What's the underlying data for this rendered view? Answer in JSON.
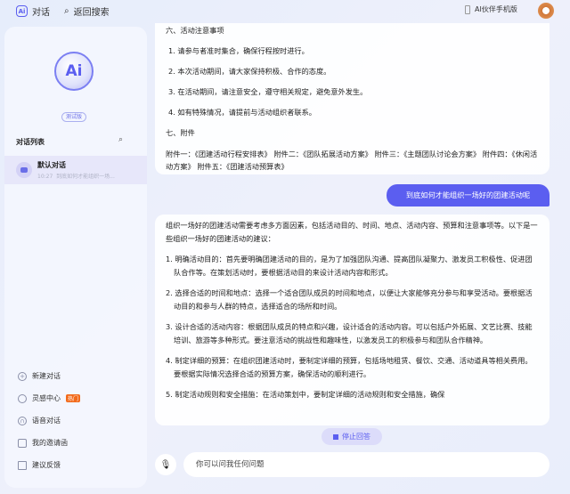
{
  "topbar": {
    "chat_label": "对话",
    "back_search": "返回搜索",
    "mobile_label": "AI伙伴手机版"
  },
  "sidebar": {
    "logo_text": "Ai",
    "beta": "测试版",
    "list_title": "对话列表",
    "conversation": {
      "name": "默认对话",
      "time": "10:27",
      "preview": "到底如何才能组织一场..."
    },
    "menu": [
      {
        "label": "新建对话",
        "icon": "plus-circle-icon"
      },
      {
        "label": "灵感中心",
        "icon": "bulb-icon",
        "badge": "热门"
      },
      {
        "label": "语音对话",
        "icon": "headphones-icon"
      },
      {
        "label": "我的邀请函",
        "icon": "mail-icon"
      },
      {
        "label": "建议反馈",
        "icon": "edit-icon"
      }
    ]
  },
  "messages": {
    "prev": {
      "h6": "六、活动注意事项",
      "items": [
        "1. 请参与者准时集合，确保行程按时进行。",
        "2. 本次活动期间，请大家保持积极、合作的态度。",
        "3. 在活动期间，请注意安全，遵守相关规定，避免意外发生。",
        "4. 如有特殊情况，请提前与活动组织者联系。"
      ],
      "h7": "七、附件",
      "attachments": "附件一：《团建活动行程安排表》 附件二：《团队拓展活动方案》 附件三：《主题团队讨论会方案》 附件四：《休闲活动方案》 附件五：《团建活动预算表》"
    },
    "user": "到底如何才能组织一场好的团建活动呢",
    "answer": {
      "intro": "组织一场好的团建活动需要考虑多方面因素，包括活动目的、时间、地点、活动内容、预算和注意事项等。以下是一些组织一场好的团建活动的建议：",
      "items": [
        "1. 明确活动目的：首先要明确团建活动的目的，是为了加强团队沟通、提高团队凝聚力、激发员工积极性、促进团队合作等。在策划活动时，要根据活动目的来设计活动内容和形式。",
        "2. 选择合适的时间和地点：选择一个适合团队成员的时间和地点，以便让大家能够充分参与和享受活动。要根据活动目的和参与人群的特点，选择适合的场所和时间。",
        "3. 设计合适的活动内容：根据团队成员的特点和兴趣，设计适合的活动内容。可以包括户外拓展、文艺比赛、技能培训、旅游等多种形式。要注意活动的挑战性和趣味性，以激发员工的积极参与和团队合作精神。",
        "4. 制定详细的预算：在组织团建活动时，要制定详细的预算，包括场地租赁、餐饮、交通、活动道具等相关费用。要根据实际情况选择合适的预算方案，确保活动的顺利进行。",
        "5. 制定活动规则和安全措施：在活动策划中，要制定详细的活动规则和安全措施，确保"
      ]
    }
  },
  "stop_label": "停止回答",
  "input": {
    "placeholder": "你可以问我任何问题"
  }
}
